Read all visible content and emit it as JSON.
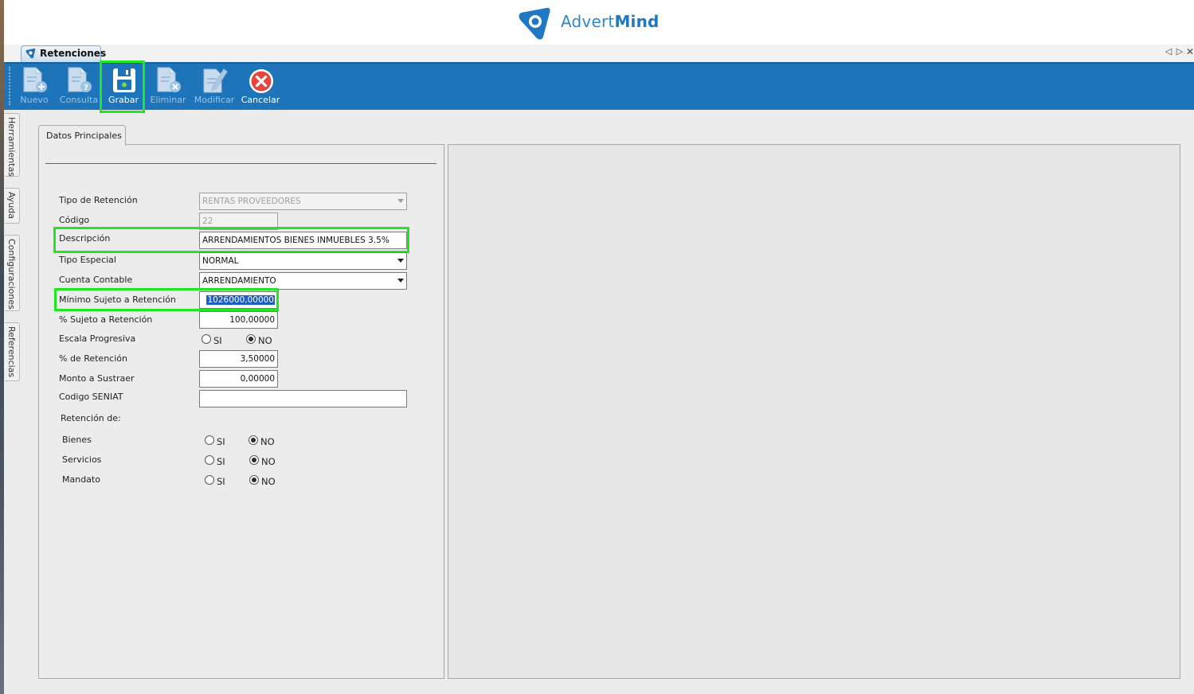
{
  "logo": {
    "text_light": "Advert",
    "text_bold": "Mind"
  },
  "module_tab": {
    "label": "Retenciones"
  },
  "toolbar": {
    "buttons": [
      {
        "label": "Nuevo",
        "state": "disabled",
        "icon": "new-document-icon"
      },
      {
        "label": "Consulta",
        "state": "disabled",
        "icon": "query-document-icon"
      },
      {
        "label": "Grabar",
        "state": "enabled",
        "icon": "floppy-disk-icon"
      },
      {
        "label": "Eliminar",
        "state": "disabled",
        "icon": "delete-document-icon"
      },
      {
        "label": "Modificar",
        "state": "disabled",
        "icon": "edit-document-icon"
      },
      {
        "label": "Cancelar",
        "state": "enabled",
        "icon": "cancel-circle-icon"
      }
    ]
  },
  "side_tabs": [
    "Herramientas",
    "Ayuda",
    "Configuraciones",
    "Referencias"
  ],
  "form": {
    "tab_label": "Datos Principales",
    "tipo_retencion": {
      "label": "Tipo de Retención",
      "value": "RENTAS PROVEEDORES"
    },
    "codigo": {
      "label": "Código",
      "value": "22"
    },
    "descripcion": {
      "label": "Descripción",
      "value": "ARRENDAMIENTOS BIENES INMUEBLES 3.5%"
    },
    "tipo_especial": {
      "label": "Tipo Especial",
      "value": "NORMAL"
    },
    "cuenta_contable": {
      "label": "Cuenta Contable",
      "value": "ARRENDAMIENTO"
    },
    "minimo_sujeto": {
      "label": "Mínimo Sujeto a Retención",
      "value": "1026000,00000"
    },
    "pct_sujeto": {
      "label": "% Sujeto a Retención",
      "value": "100,00000"
    },
    "escala_progresiva": {
      "label": "Escala Progresiva",
      "si": "SI",
      "no": "NO",
      "selected": "NO"
    },
    "pct_retencion": {
      "label": "% de Retención",
      "value": "3,50000"
    },
    "monto_sustraer": {
      "label": "Monto a Sustraer",
      "value": "0,00000"
    },
    "codigo_seniat": {
      "label": "Codigo SENIAT",
      "value": ""
    },
    "retencion_de": {
      "label": "Retención de:",
      "items": [
        {
          "label": "Bienes",
          "si": "SI",
          "no": "NO",
          "selected": "NO"
        },
        {
          "label": "Servicios",
          "si": "SI",
          "no": "NO",
          "selected": "NO"
        },
        {
          "label": "Mandato",
          "si": "SI",
          "no": "NO",
          "selected": "NO"
        }
      ]
    }
  },
  "colors": {
    "toolbar": "#1e74b8",
    "highlight": "#22e622",
    "brand": "#2f86c8",
    "cancel": "#e2463c"
  }
}
